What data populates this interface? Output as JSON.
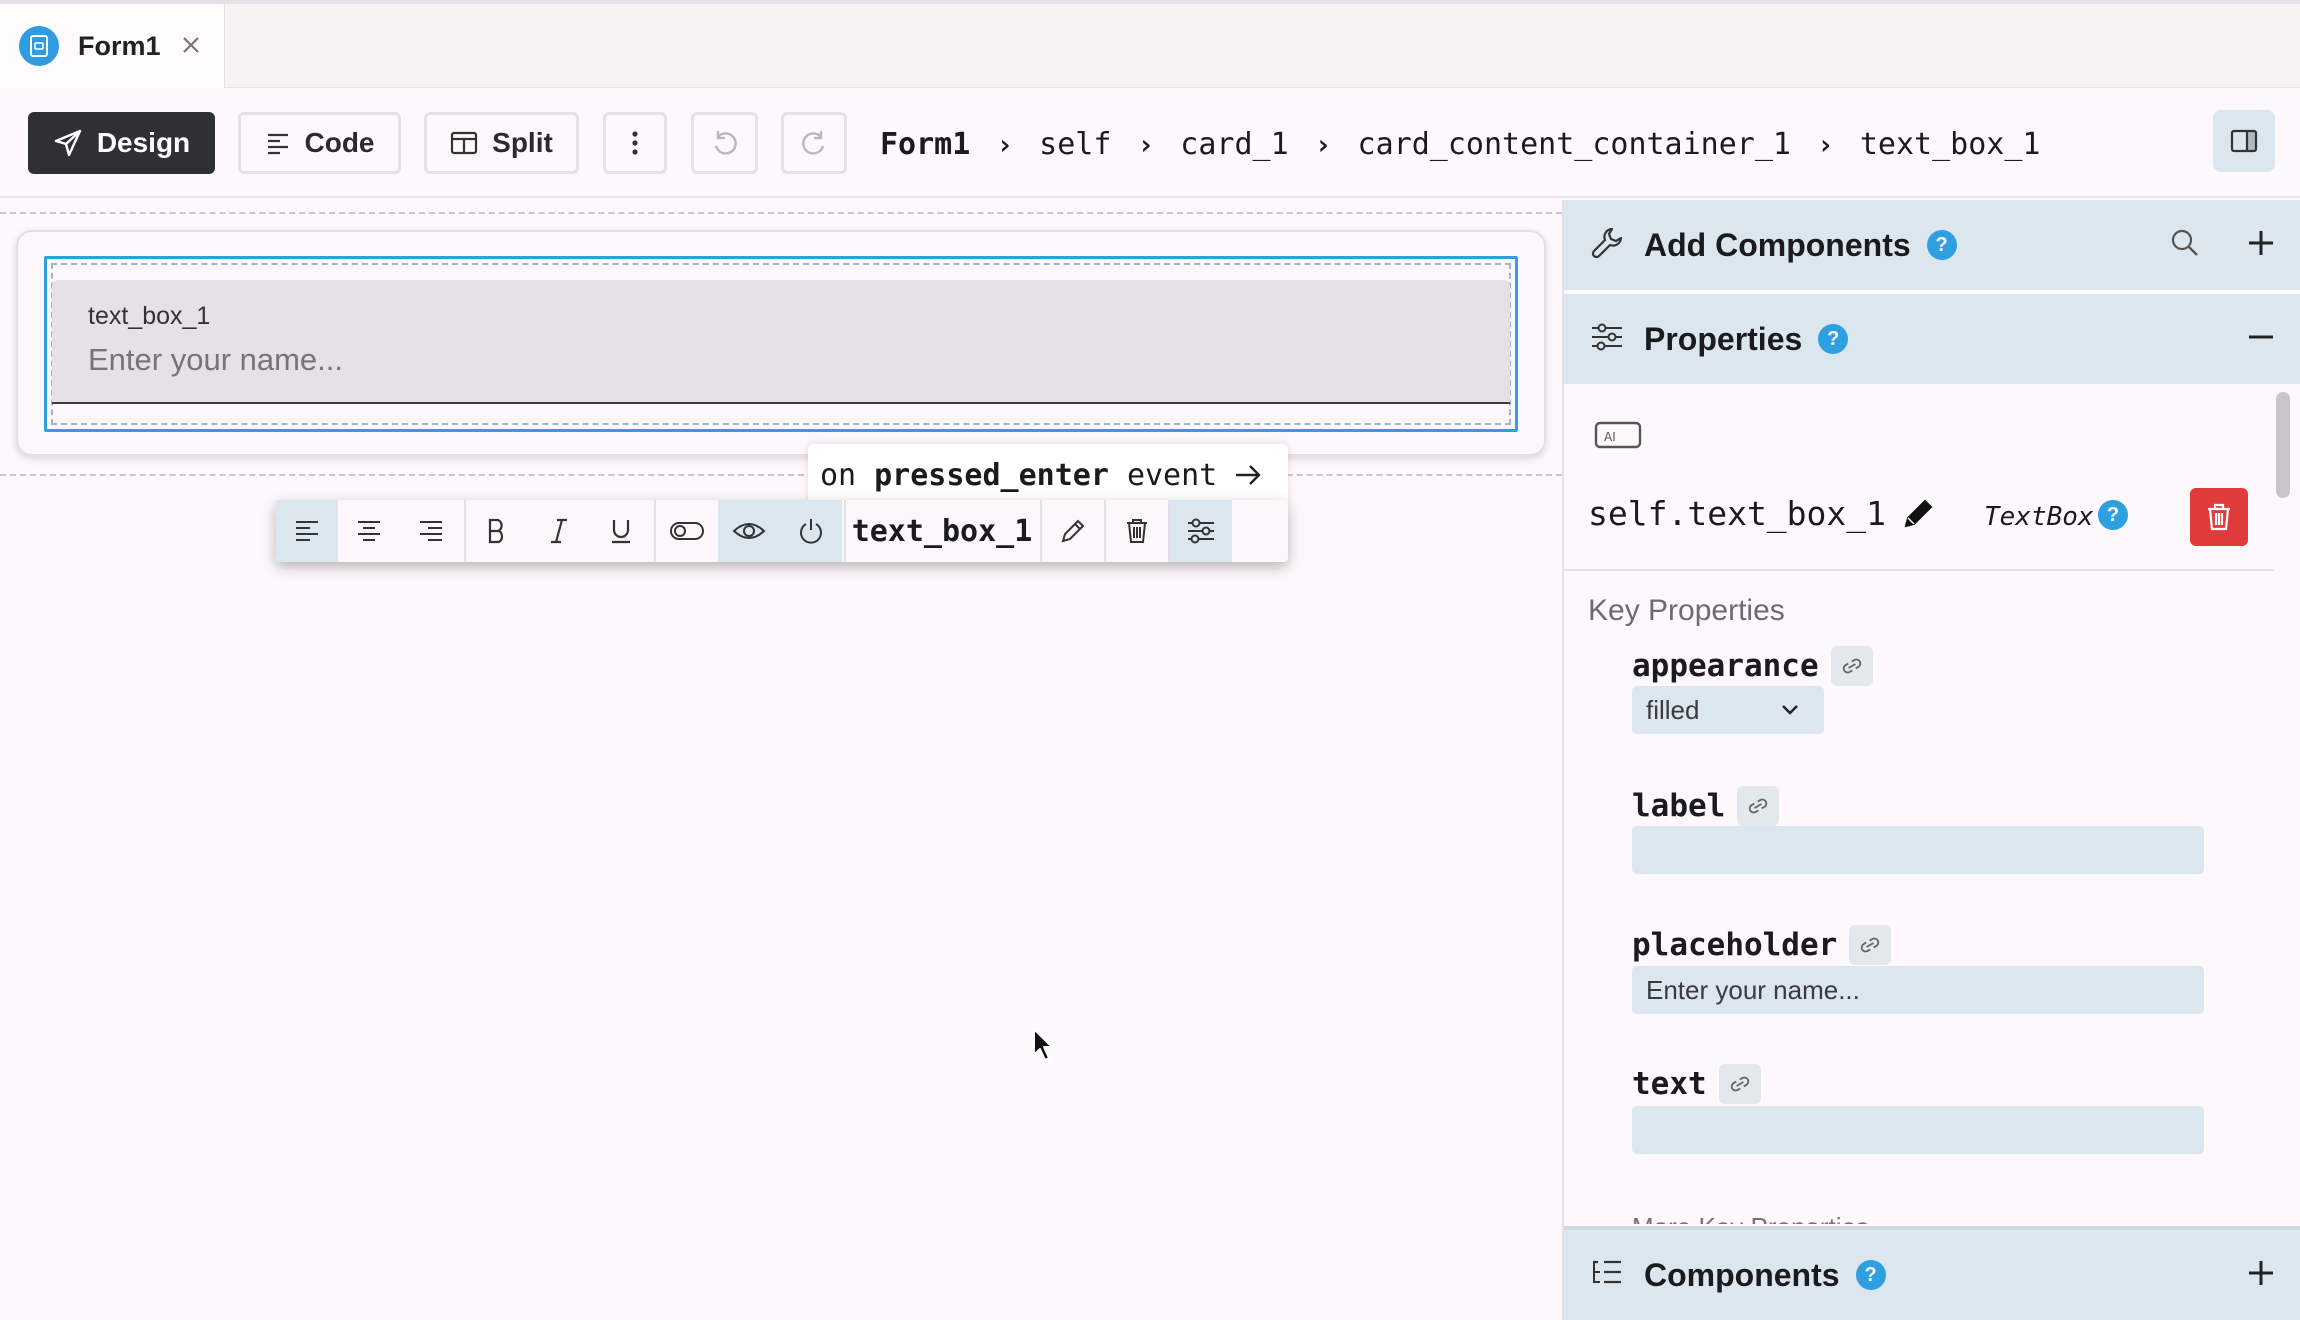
{
  "tab": {
    "label": "Form1"
  },
  "toolbar": {
    "design_label": "Design",
    "code_label": "Code",
    "split_label": "Split"
  },
  "breadcrumb": [
    "Form1",
    "self",
    "card_1",
    "card_content_container_1",
    "text_box_1"
  ],
  "canvas": {
    "textbox_label": "text_box_1",
    "textbox_placeholder": "Enter your name...",
    "event_tip": {
      "prefix": "on",
      "event": "pressed_enter",
      "suffix": "event"
    },
    "floating_toolbar": {
      "component_name": "text_box_1"
    }
  },
  "panel": {
    "add_components_title": "Add Components",
    "properties_title": "Properties",
    "components_title": "Components",
    "component_name": "self.text_box_1",
    "component_type": "TextBox",
    "key_properties_title": "Key Properties",
    "properties": {
      "appearance": {
        "name": "appearance",
        "value": "filled"
      },
      "label": {
        "name": "label",
        "value": ""
      },
      "placeholder": {
        "name": "placeholder",
        "value": "Enter your name..."
      },
      "text": {
        "name": "text",
        "value": ""
      }
    },
    "more_text": "More Key Properties"
  },
  "colors": {
    "accent": "#2ea0e0",
    "panel_header": "#dbe6ee",
    "delete": "#e23b3b",
    "design_active": "#2f3033"
  }
}
